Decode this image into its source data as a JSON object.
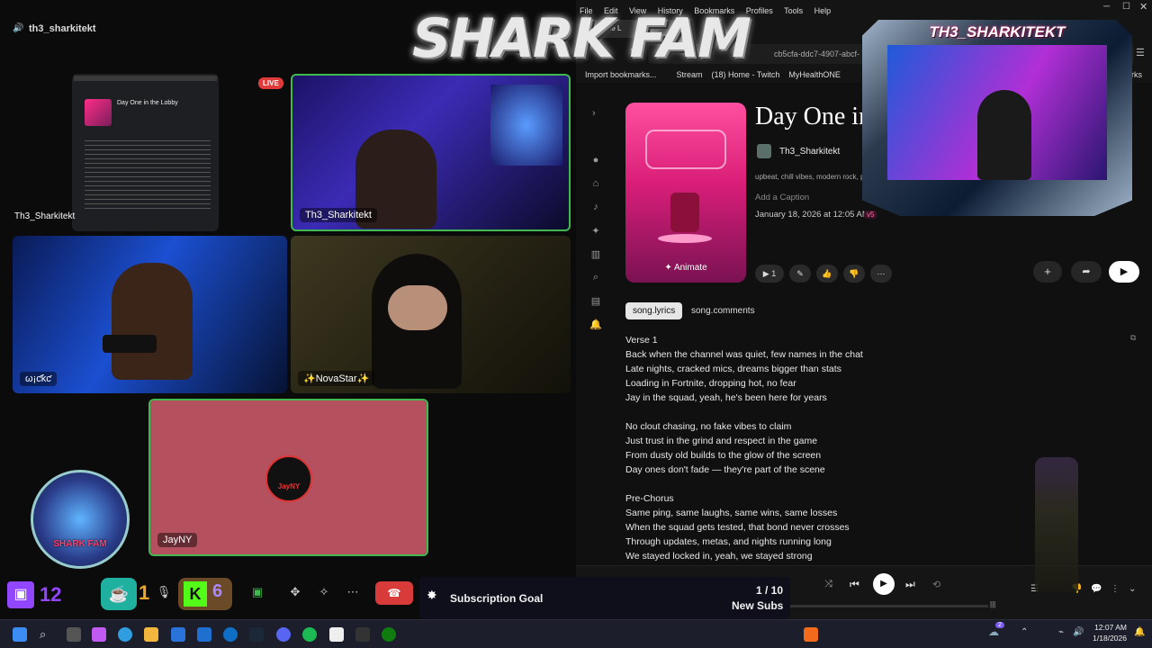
{
  "call": {
    "server_user": "th3_sharkitekt",
    "live_badge": "LIVE",
    "participants": [
      {
        "name": "Th3_Sharkitekt"
      },
      {
        "name": "Th3_Sharkitekt"
      },
      {
        "name": "ω¡ƈƙƈ"
      },
      {
        "name": "✨NovaStar✨"
      },
      {
        "name": "JayNY"
      }
    ],
    "twitch_count": "12",
    "kofi_count": "1",
    "kick_count": "6",
    "avatar_label": "JayNY",
    "screen_preview_title": "Day One in the Lobby"
  },
  "browser": {
    "menu": [
      "File",
      "Edit",
      "View",
      "History",
      "Bookmarks",
      "Profiles",
      "Tools",
      "Help"
    ],
    "tab_title": "c in the L",
    "url_fragment": "cb5cfa-ddc7-4907-abcf-",
    "bookmarks": [
      "Import bookmarks...",
      "Stream",
      "(18) Home - Twitch",
      "MyHealthONE",
      "arks"
    ]
  },
  "song": {
    "title": "Day One in",
    "artist": "Th3_Sharkitekt",
    "tags": "upbeat, chill vibes, modern rock, pro",
    "caption_placeholder": "Add a Caption",
    "date": "January 18, 2026 at 12:05 AM",
    "version": "v5",
    "animate_label": "Animate",
    "play_count": "1",
    "tabs": [
      "song.lyrics",
      "song.comments"
    ],
    "lyrics": [
      "Verse 1",
      "Back when the channel was quiet, few names in the chat",
      "Late nights, cracked mics, dreams bigger than stats",
      "Loading in Fortnite, dropping hot, no fear",
      "Jay in the squad, yeah, he's been here for years",
      "",
      "No clout chasing, no fake vibes to claim",
      "Just trust in the grind and respect in the game",
      "From dusty old builds to the glow of the screen",
      "Day ones don't fade — they're part of the scene",
      "",
      "Pre-Chorus",
      "Same ping, same laughs, same wins, same losses",
      "When the squad gets tested, that bond never crosses",
      "Through updates, metas, and nights running long",
      "We stayed locked in, yeah, we stayed strong"
    ]
  },
  "overlay": {
    "brand": "SHARK FAM",
    "cam_label": "TH3_SHARKITEKT",
    "logo_text": "SHARK FAM"
  },
  "goal": {
    "label": "Subscription Goal",
    "count": "1 / 10",
    "unit": "New Subs",
    "progress": 0.1
  },
  "taskbar": {
    "time": "12:07 AM",
    "date": "1/18/2026",
    "notif": "2"
  },
  "colors": {
    "accent_pink": "#ff2d8a",
    "jay_tile": "#b5505e",
    "twitch": "#9146ff",
    "kick": "#53fc18"
  }
}
